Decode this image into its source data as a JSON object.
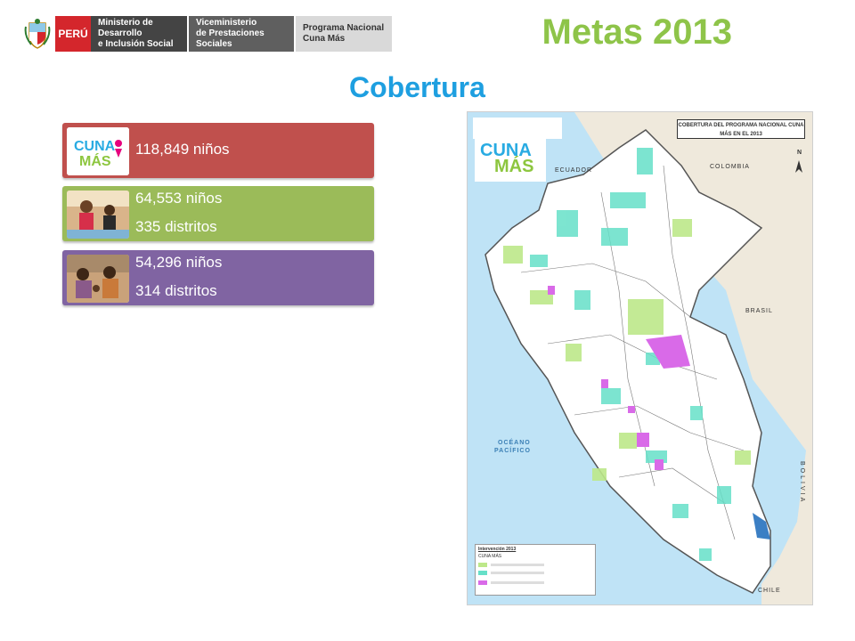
{
  "header": {
    "country": "PERÚ",
    "block1": [
      "Ministerio de Desarrollo",
      "e Inclusión Social"
    ],
    "block2": [
      "Viceministerio",
      "de Prestaciones Sociales"
    ],
    "block3": [
      "Programa Nacional",
      "Cuna Más"
    ]
  },
  "title": "Metas 2013",
  "subtitle": "Cobertura",
  "cards": [
    {
      "lines": [
        "118,849 niños"
      ],
      "color": "#c0504d",
      "thumb": "cuna-mas-logo"
    },
    {
      "lines": [
        "64,553 niños",
        "335 distritos"
      ],
      "color": "#9bbb59",
      "thumb": "children-photo"
    },
    {
      "lines": [
        "54,296 niños",
        "314 distritos"
      ],
      "color": "#8064a2",
      "thumb": "family-photo"
    }
  ],
  "map": {
    "title": "COBERTURA DEL PROGRAMA NACIONAL CUNA MÁS EN EL 2013",
    "neighbors": [
      "ECUADOR",
      "COLOMBIA",
      "BRASIL",
      "BOLIVIA",
      "CHILE"
    ],
    "sea": [
      "OCÉANO",
      "PACÍFICO"
    ],
    "north": "N",
    "logo_lines": [
      "CUNA",
      "MÁS"
    ],
    "legend": {
      "title": "Intervención 2013",
      "header": "CUNA MÁS"
    }
  }
}
